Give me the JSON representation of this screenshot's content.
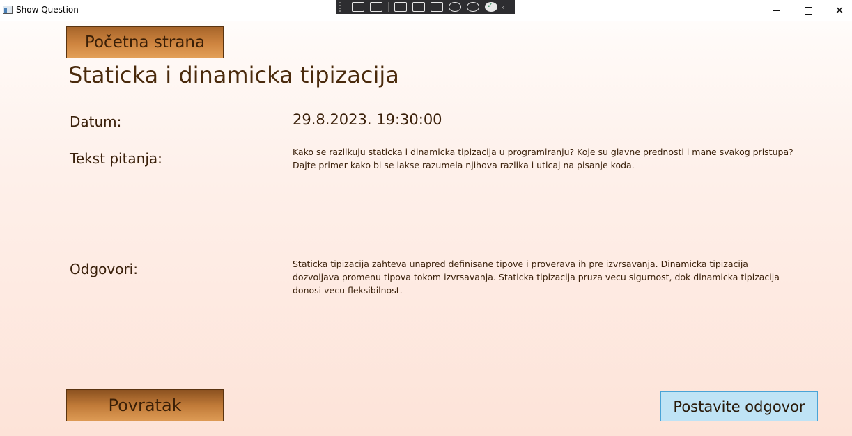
{
  "window": {
    "title": "Show Question",
    "minimize_glyph": "",
    "maximize_glyph": "",
    "close_glyph": "✕"
  },
  "devtools": {
    "icons": [
      "select-visual-icon",
      "layout-adorner-icon",
      "track-focus-icon",
      "binding-failures-icon",
      "accessibility-icon",
      "check-icon",
      "collapse-chevron-icon"
    ]
  },
  "nav": {
    "home_label": "Početna strana",
    "back_label": "Povratak",
    "answer_label": "Postavite odgovor"
  },
  "question": {
    "title": "Staticka i dinamicka tipizacija",
    "date_label": "Datum:",
    "date_value": "29.8.2023. 19:30:00",
    "text_label": "Tekst pitanja:",
    "text_value": "Kako se razlikuju staticka i dinamicka tipizacija u programiranju? Koje su glavne prednosti i mane svakog pristupa? Dajte primer kako bi se lakse razumela njihova razlika i uticaj na pisanje koda.",
    "answers_label": "Odgovori:",
    "answers_value": "Staticka tipizacija zahteva unapred definisane tipove i proverava ih pre izvrsavanja. Dinamicka tipizacija dozvoljava promenu tipova tokom izvrsavanja. Staticka tipizacija pruza vecu sigurnost, dok dinamicka tipizacija donosi vecu fleksibilnost."
  },
  "colors": {
    "brown_button": "#cf8540",
    "answer_button": "#bfe3f5",
    "text": "#3a200a"
  }
}
